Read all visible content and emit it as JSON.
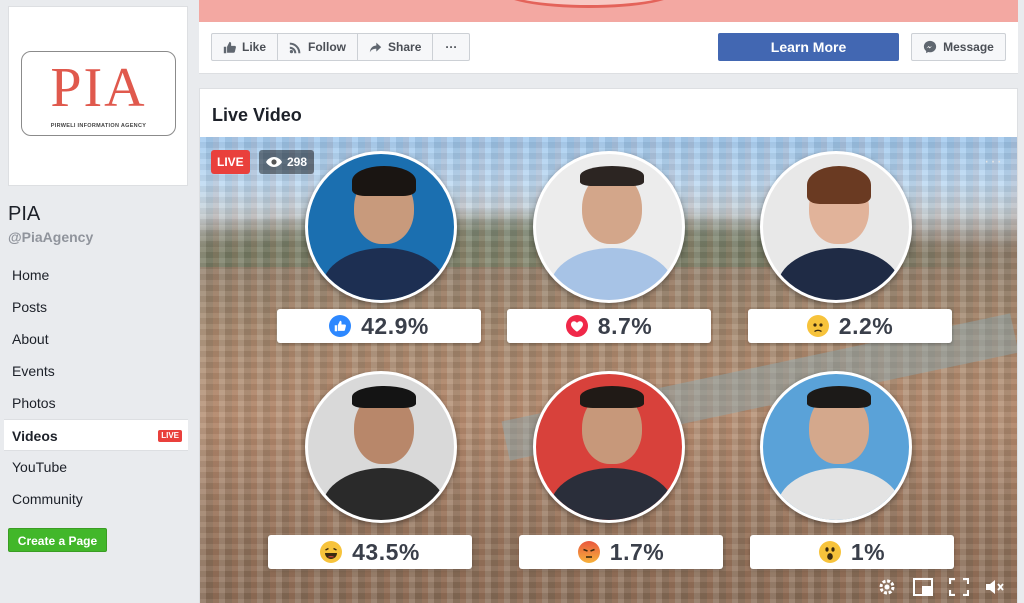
{
  "sidebar": {
    "logo_text": "PIA",
    "logo_subtext": "PIRWELI INFORMATION AGENCY",
    "page_name": "PIA",
    "handle": "@PiaAgency",
    "nav": [
      {
        "label": "Home"
      },
      {
        "label": "Posts"
      },
      {
        "label": "About"
      },
      {
        "label": "Events"
      },
      {
        "label": "Photos"
      },
      {
        "label": "Videos",
        "badge": "LIVE"
      },
      {
        "label": "YouTube"
      },
      {
        "label": "Community"
      }
    ],
    "create_page": "Create a Page"
  },
  "actions": {
    "like": "Like",
    "follow": "Follow",
    "share": "Share",
    "more": "···",
    "learn_more": "Learn More",
    "message": "Message"
  },
  "video": {
    "section_title": "Live Video",
    "live_label": "LIVE",
    "viewers": "298",
    "more": "···",
    "results": [
      {
        "reaction": "like",
        "pct": "42.9%"
      },
      {
        "reaction": "love",
        "pct": "8.7%"
      },
      {
        "reaction": "sad",
        "pct": "2.2%"
      },
      {
        "reaction": "haha",
        "pct": "43.5%"
      },
      {
        "reaction": "angry",
        "pct": "1.7%"
      },
      {
        "reaction": "wow",
        "pct": "1%"
      }
    ]
  },
  "colors": {
    "facebook_blue": "#4267b2",
    "live_red": "#e9403c",
    "create_green": "#42b72a",
    "logo_red": "#e0594d"
  }
}
